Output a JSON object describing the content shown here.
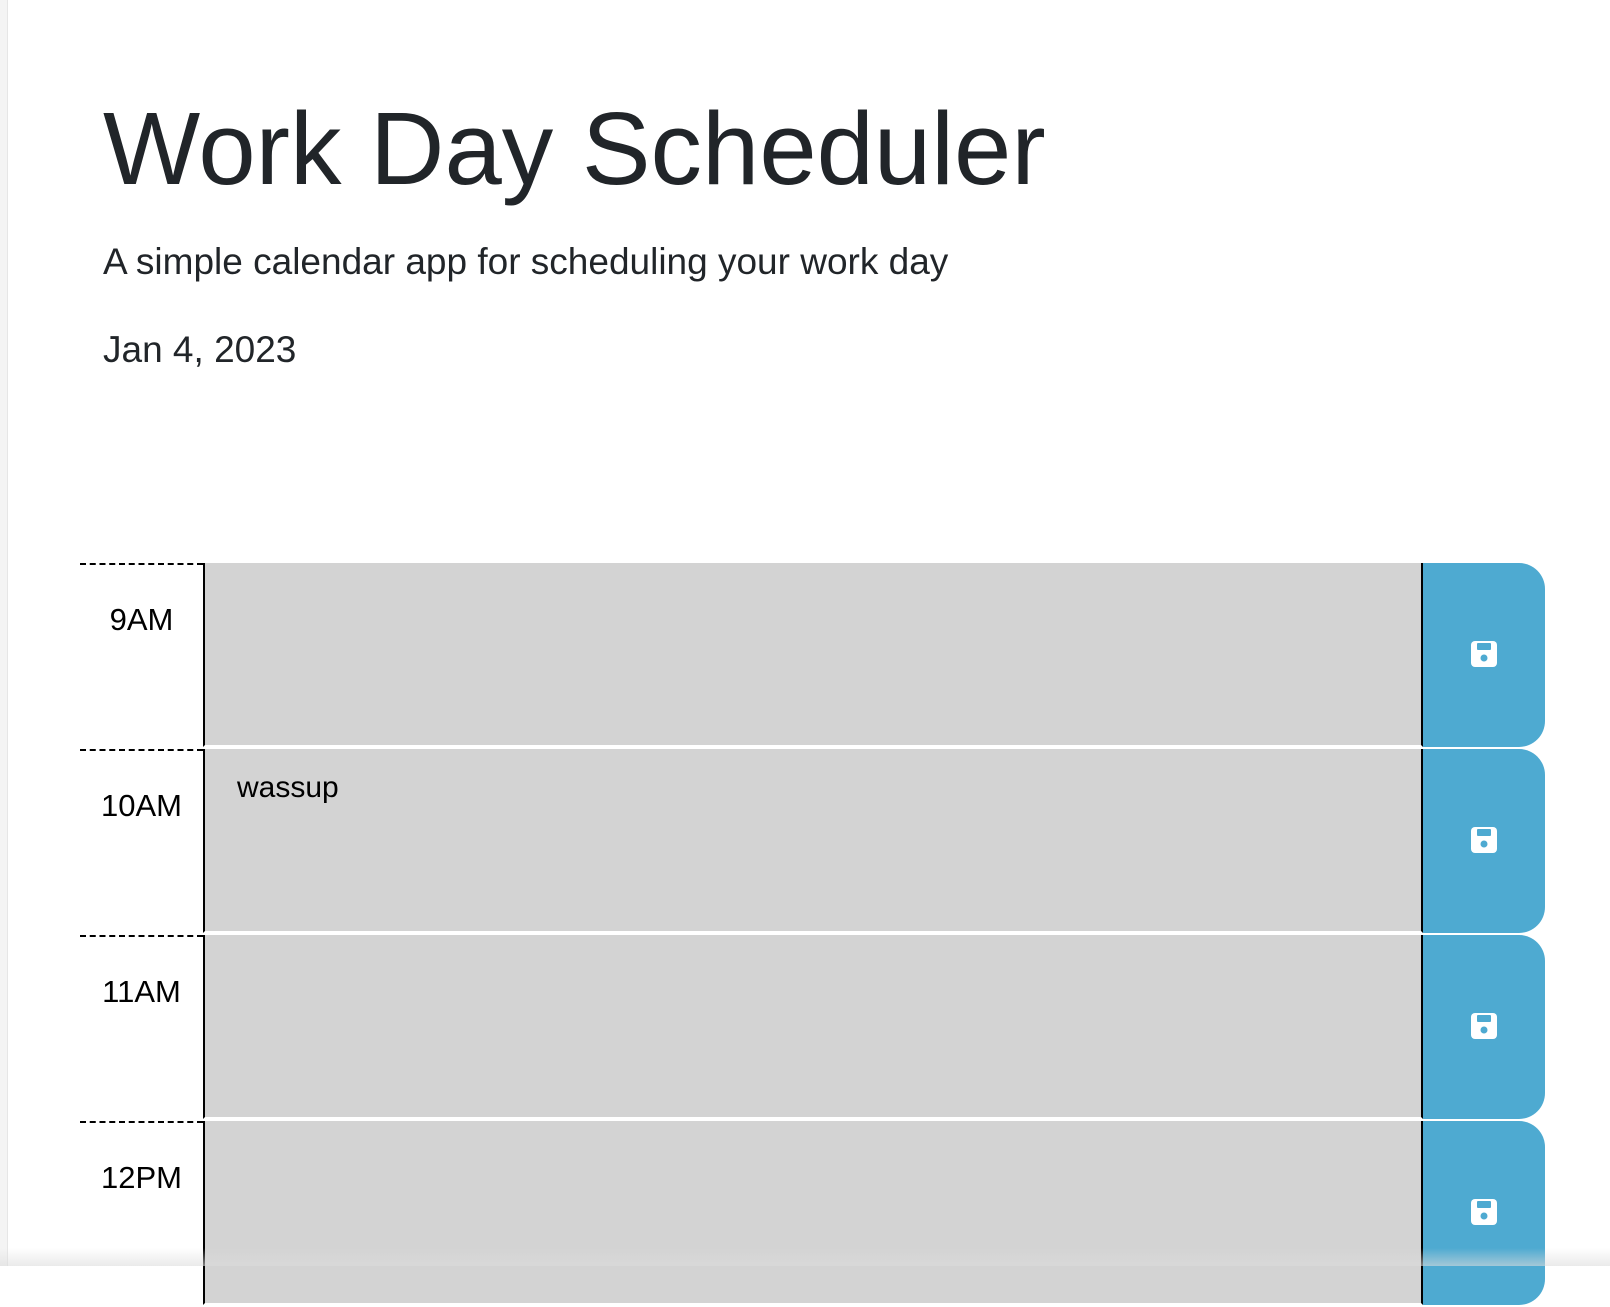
{
  "header": {
    "title": "Work Day Scheduler",
    "subtitle": "A simple calendar app for scheduling your work day",
    "date": "Jan 4, 2023"
  },
  "rows": [
    {
      "hour": "9AM",
      "text": ""
    },
    {
      "hour": "10AM",
      "text": "wassup"
    },
    {
      "hour": "11AM",
      "text": ""
    },
    {
      "hour": "12PM",
      "text": ""
    }
  ],
  "icons": {
    "save": "save-icon"
  },
  "colors": {
    "past_block": "#d3d3d3",
    "save_button": "#4eaad1",
    "icon": "#ffffff",
    "text": "#212529"
  }
}
